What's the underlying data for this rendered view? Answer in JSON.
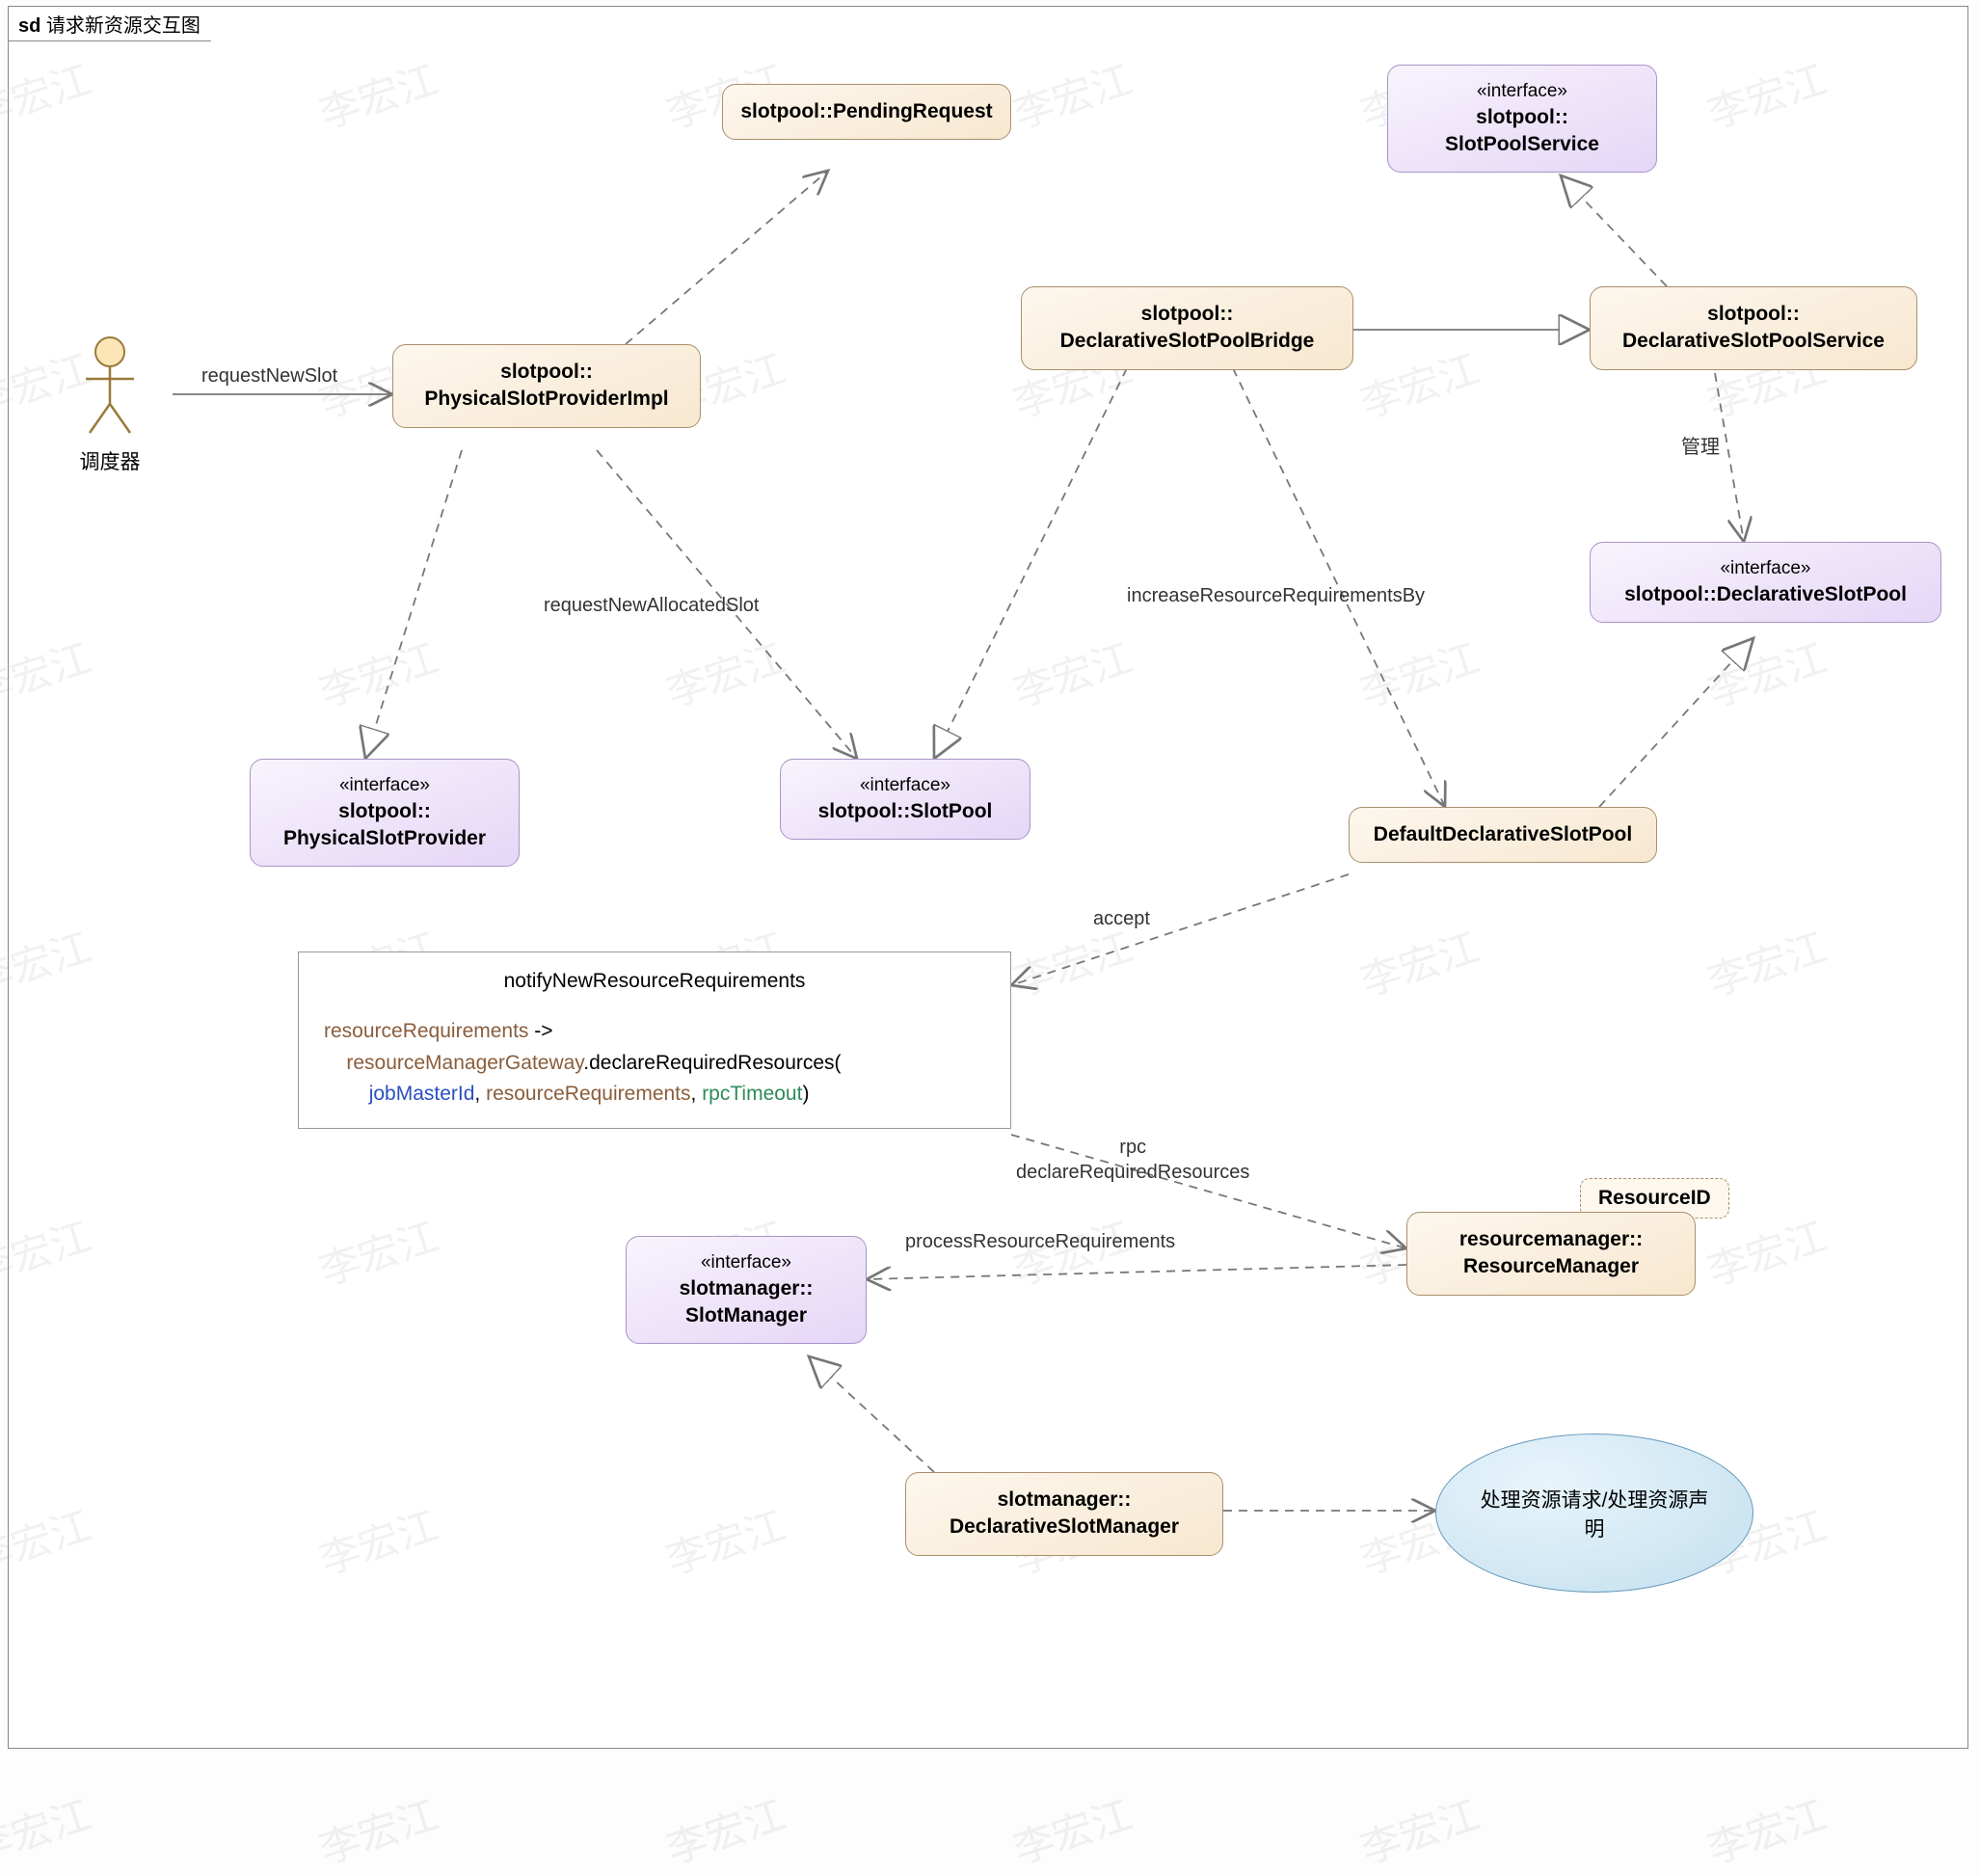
{
  "frame": {
    "prefix": "sd",
    "title": "请求新资源交互图"
  },
  "watermark_text": "李宏江",
  "actor": {
    "label": "调度器"
  },
  "nodes": {
    "pendingRequest": {
      "name": "slotpool::PendingRequest"
    },
    "physicalSlotProviderImpl": {
      "name": "slotpool::\nPhysicalSlotProviderImpl"
    },
    "slotPoolService": {
      "stereo": "«interface»",
      "name": "slotpool::\nSlotPoolService"
    },
    "declarativeSlotPoolBridge": {
      "name": "slotpool::\nDeclarativeSlotPoolBridge"
    },
    "declarativeSlotPoolService": {
      "name": "slotpool::\nDeclarativeSlotPoolService"
    },
    "declarativeSlotPool": {
      "stereo": "«interface»",
      "name": "slotpool::DeclarativeSlotPool"
    },
    "physicalSlotProvider": {
      "stereo": "«interface»",
      "name": "slotpool::\nPhysicalSlotProvider"
    },
    "slotPool": {
      "stereo": "«interface»",
      "name": "slotpool::SlotPool"
    },
    "defaultDeclarativeSlotPool": {
      "name": "DefaultDeclarativeSlotPool"
    },
    "resourceManager": {
      "name": "resourcemanager::\nResourceManager"
    },
    "resourceId": {
      "name": "ResourceID"
    },
    "slotManager": {
      "stereo": "«interface»",
      "name": "slotmanager::\nSlotManager"
    },
    "declarativeSlotManager": {
      "name": "slotmanager::\nDeclarativeSlotManager"
    }
  },
  "ellipse": {
    "text": "处理资源请求/处理资源声\n明"
  },
  "edges": {
    "requestNewSlot": "requestNewSlot",
    "requestNewAllocatedSlot": "requestNewAllocatedSlot",
    "increaseResourceRequirementsBy": "increaseResourceRequirementsBy",
    "manage": "管理",
    "accept": "accept",
    "rpc_line1": "rpc",
    "rpc_line2": "declareRequiredResources",
    "processResourceRequirements": "processResourceRequirements"
  },
  "note": {
    "title": "notifyNewResourceRequirements",
    "code_lines": [
      {
        "segments": [
          {
            "t": "resourceRequirements",
            "c": "kw1"
          },
          {
            "t": " -> ",
            "c": ""
          }
        ]
      },
      {
        "segments": [
          {
            "t": "    ",
            "c": ""
          },
          {
            "t": "resourceManagerGateway",
            "c": "kw1"
          },
          {
            "t": ".declareRequiredResources(",
            "c": ""
          }
        ]
      },
      {
        "segments": [
          {
            "t": "        ",
            "c": ""
          },
          {
            "t": "jobMasterId",
            "c": "kw2"
          },
          {
            "t": ", ",
            "c": ""
          },
          {
            "t": "resourceRequirements",
            "c": "kw1"
          },
          {
            "t": ", ",
            "c": ""
          },
          {
            "t": "rpcTimeout",
            "c": "kw3"
          },
          {
            "t": ")",
            "c": ""
          }
        ]
      }
    ]
  }
}
